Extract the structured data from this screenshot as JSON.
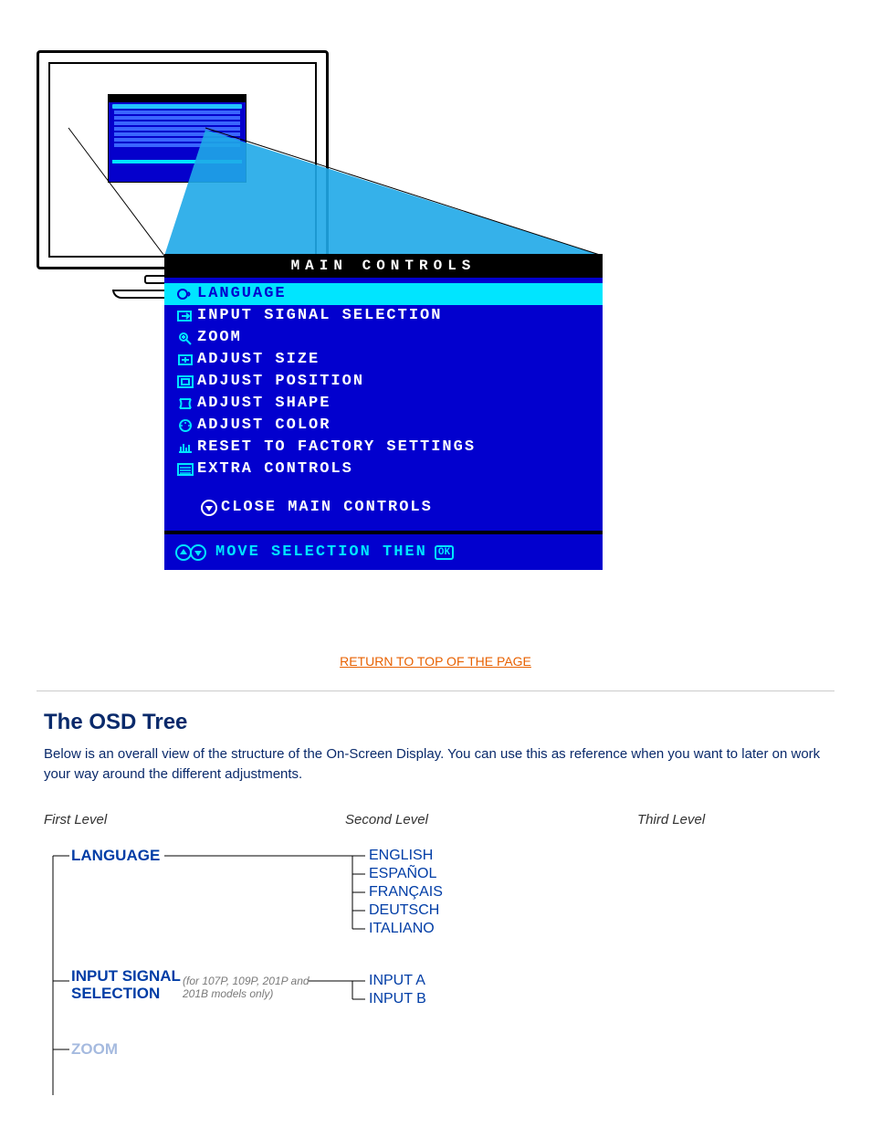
{
  "osd": {
    "title": "MAIN CONTROLS",
    "items": [
      {
        "icon": "language-icon",
        "label": "LANGUAGE",
        "selected": true
      },
      {
        "icon": "input-icon",
        "label": "INPUT SIGNAL SELECTION",
        "selected": false
      },
      {
        "icon": "zoom-icon",
        "label": "ZOOM",
        "selected": false
      },
      {
        "icon": "size-icon",
        "label": "ADJUST SIZE",
        "selected": false
      },
      {
        "icon": "position-icon",
        "label": "ADJUST POSITION",
        "selected": false
      },
      {
        "icon": "shape-icon",
        "label": "ADJUST SHAPE",
        "selected": false
      },
      {
        "icon": "color-icon",
        "label": "ADJUST COLOR",
        "selected": false
      },
      {
        "icon": "reset-icon",
        "label": "RESET TO FACTORY SETTINGS",
        "selected": false
      },
      {
        "icon": "extra-icon",
        "label": "EXTRA CONTROLS",
        "selected": false
      }
    ],
    "close_label": "CLOSE MAIN CONTROLS",
    "hint_text": "MOVE SELECTION THEN",
    "hint_ok": "OK"
  },
  "links": {
    "return_top": "RETURN TO TOP OF THE PAGE"
  },
  "section2": {
    "title": "The OSD Tree",
    "body": "Below is an overall view of the structure of the On-Screen Display. You can use this as reference when you want to later on work your way around the different adjustments."
  },
  "tree": {
    "headers": {
      "first": "First Level",
      "second": "Second Level",
      "third": "Third Level"
    },
    "rows": [
      {
        "l1": "LANGUAGE",
        "l2": [
          "ENGLISH",
          "ESPAÑOL",
          "FRANÇAIS",
          "DEUTSCH",
          "ITALIANO"
        ]
      },
      {
        "l1": "INPUT SIGNAL SELECTION",
        "note": "(for 107P, 109P, 201P and 201B models only)",
        "l2": [
          "INPUT A",
          "INPUT B"
        ]
      }
    ],
    "partial": "ZOOM"
  }
}
